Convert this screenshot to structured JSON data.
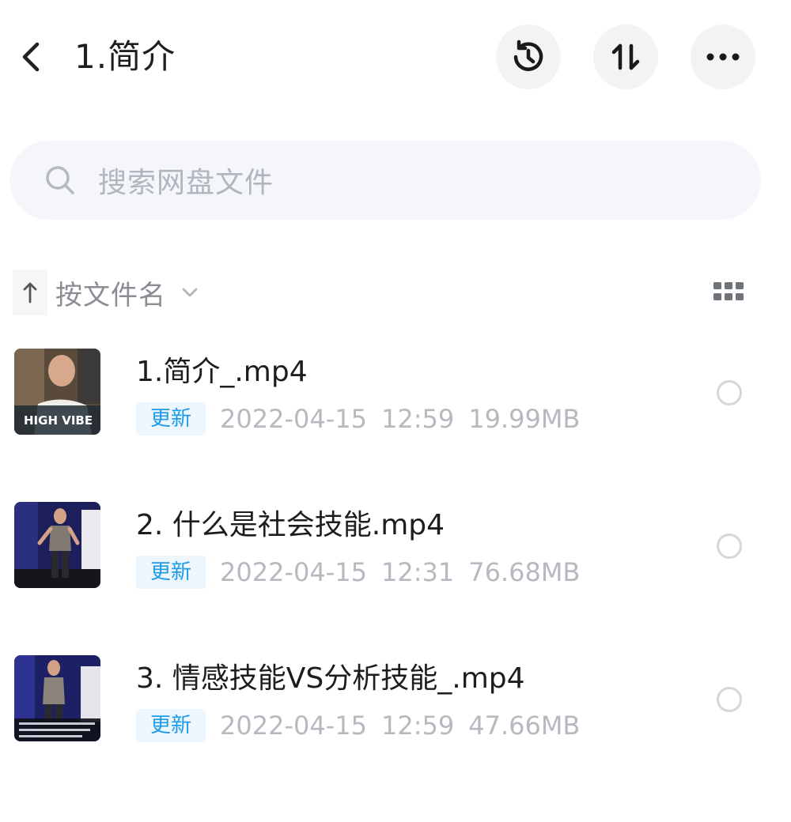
{
  "header": {
    "title": "1.简介",
    "buttons": [
      "history-icon",
      "sort-order-icon",
      "more-icon"
    ]
  },
  "search": {
    "placeholder": "搜索网盘文件"
  },
  "sortbar": {
    "label": "按文件名"
  },
  "files": [
    {
      "name": "1.简介_.mp4",
      "badge": "更新",
      "date": "2022-04-15",
      "time": "12:59",
      "size": "19.99MB"
    },
    {
      "name": "2. 什么是社会技能.mp4",
      "badge": "更新",
      "date": "2022-04-15",
      "time": "12:31",
      "size": "76.68MB"
    },
    {
      "name": "3. 情感技能VS分析技能_.mp4",
      "badge": "更新",
      "date": "2022-04-15",
      "time": "12:59",
      "size": "47.66MB"
    }
  ],
  "thumbnail_captions": {
    "file0": "HIGH VIBE"
  },
  "colors": {
    "accent": "#1e9be8",
    "badge_bg": "#eef6fd",
    "muted_text": "#b6b9c0",
    "button_bg": "#f2f3f5",
    "search_bg": "#f4f6fa"
  }
}
